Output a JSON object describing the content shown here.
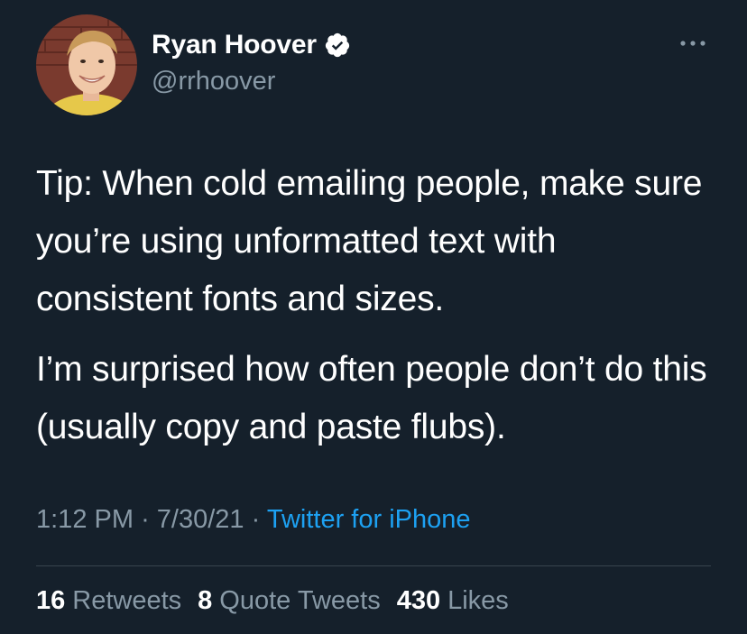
{
  "author": {
    "display_name": "Ryan Hoover",
    "handle": "@rrhoover",
    "verified": true,
    "avatar_icon": "user-avatar"
  },
  "tweet": {
    "paragraphs": [
      "Tip: When cold emailing people, make sure you’re using unformatted text with consistent fonts and sizes.",
      "I’m surprised how often people don’t do this (usually copy and paste flubs)."
    ]
  },
  "meta": {
    "time": "1:12 PM",
    "separator": "·",
    "date": "7/30/21",
    "source": "Twitter for iPhone"
  },
  "stats": {
    "retweets_count": "16",
    "retweets_label": "Retweets",
    "quotes_count": "8",
    "quotes_label": "Quote Tweets",
    "likes_count": "430",
    "likes_label": "Likes"
  },
  "colors": {
    "background": "#15202b",
    "primary_text": "#ffffff",
    "secondary_text": "#8899a6",
    "link": "#1da1f2",
    "divider": "#38444d"
  },
  "icons": {
    "verified": "verified-badge-icon",
    "more": "more-horizontal-icon"
  }
}
